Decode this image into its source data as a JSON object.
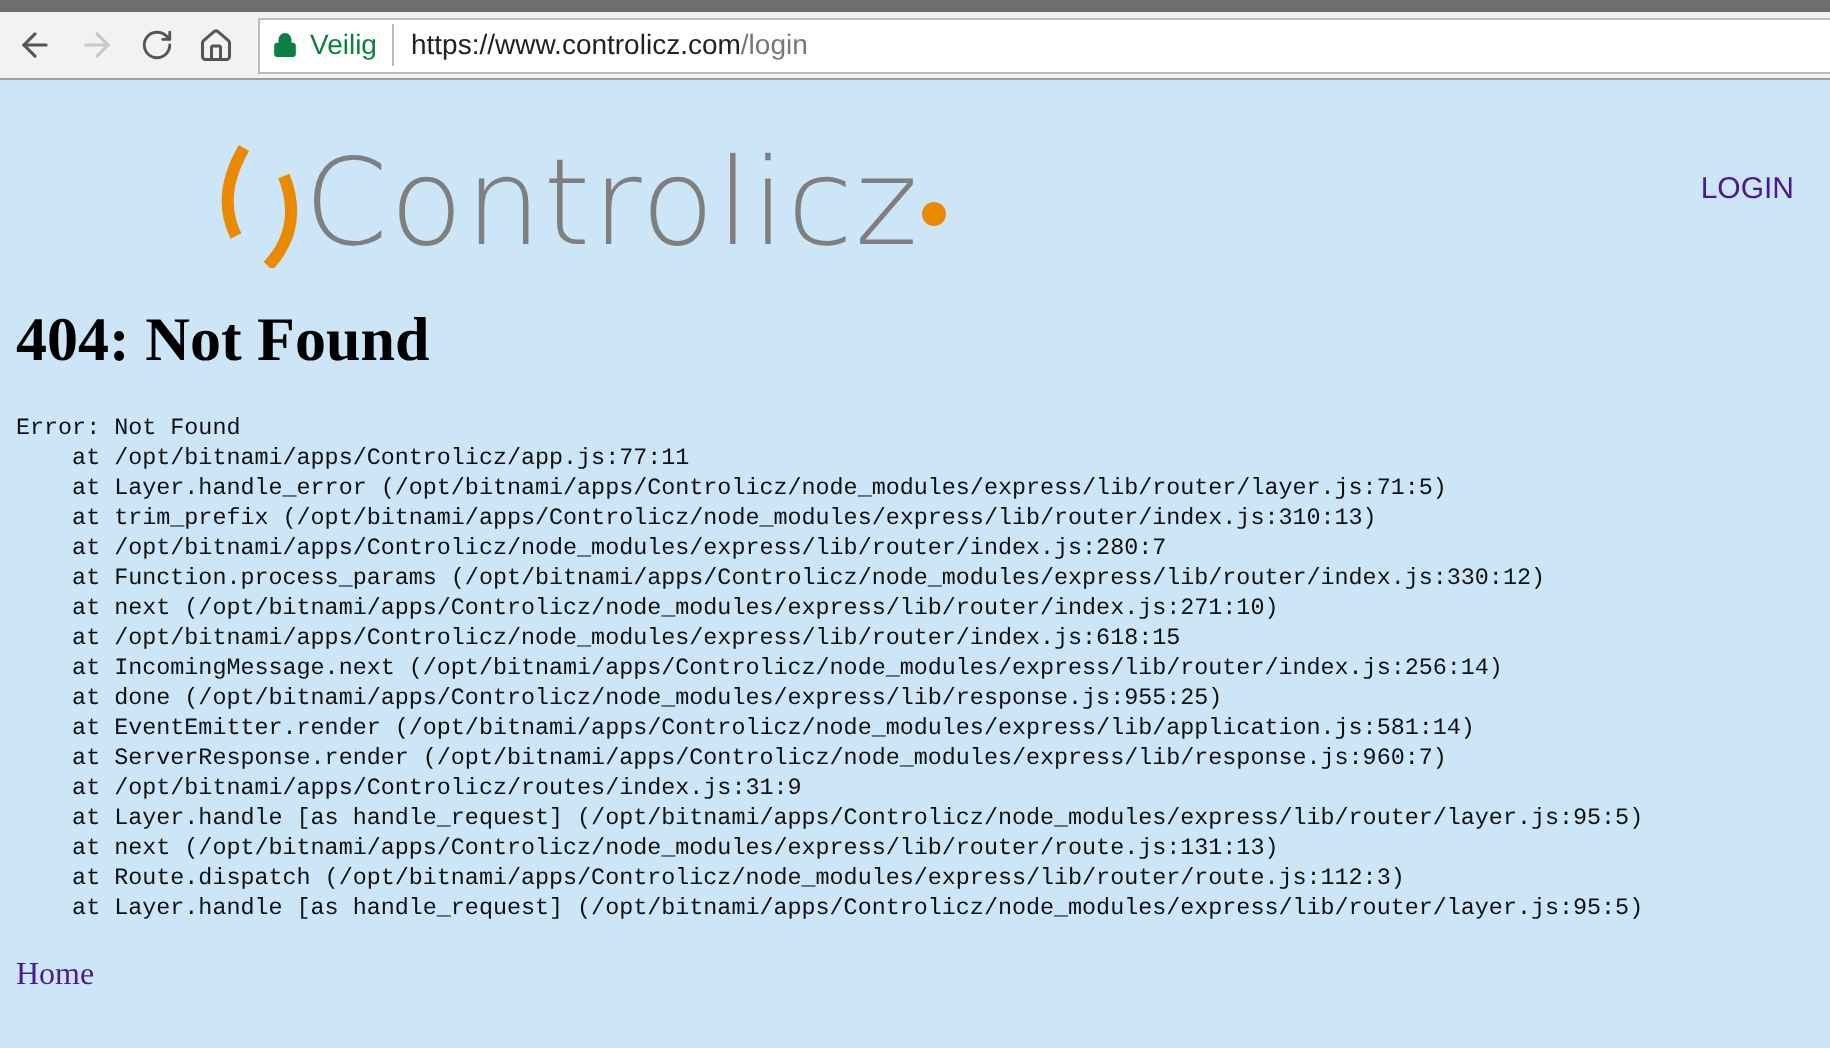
{
  "browser": {
    "security_label": "Veilig",
    "url_host": "https://www.controlicz.com",
    "url_path": "/login",
    "forward_disabled": true
  },
  "header": {
    "logo_text": "Controlicz",
    "nav_link": "LOGIN"
  },
  "heading": "404: Not Found",
  "error_lines": [
    "Error: Not Found",
    "    at /opt/bitnami/apps/Controlicz/app.js:77:11",
    "    at Layer.handle_error (/opt/bitnami/apps/Controlicz/node_modules/express/lib/router/layer.js:71:5)",
    "    at trim_prefix (/opt/bitnami/apps/Controlicz/node_modules/express/lib/router/index.js:310:13)",
    "    at /opt/bitnami/apps/Controlicz/node_modules/express/lib/router/index.js:280:7",
    "    at Function.process_params (/opt/bitnami/apps/Controlicz/node_modules/express/lib/router/index.js:330:12)",
    "    at next (/opt/bitnami/apps/Controlicz/node_modules/express/lib/router/index.js:271:10)",
    "    at /opt/bitnami/apps/Controlicz/node_modules/express/lib/router/index.js:618:15",
    "    at IncomingMessage.next (/opt/bitnami/apps/Controlicz/node_modules/express/lib/router/index.js:256:14)",
    "    at done (/opt/bitnami/apps/Controlicz/node_modules/express/lib/response.js:955:25)",
    "    at EventEmitter.render (/opt/bitnami/apps/Controlicz/node_modules/express/lib/application.js:581:14)",
    "    at ServerResponse.render (/opt/bitnami/apps/Controlicz/node_modules/express/lib/response.js:960:7)",
    "    at /opt/bitnami/apps/Controlicz/routes/index.js:31:9",
    "    at Layer.handle [as handle_request] (/opt/bitnami/apps/Controlicz/node_modules/express/lib/router/layer.js:95:5)",
    "    at next (/opt/bitnami/apps/Controlicz/node_modules/express/lib/router/route.js:131:13)",
    "    at Route.dispatch (/opt/bitnami/apps/Controlicz/node_modules/express/lib/router/route.js:112:3)",
    "    at Layer.handle [as handle_request] (/opt/bitnami/apps/Controlicz/node_modules/express/lib/router/layer.js:95:5)"
  ],
  "footer_link": "Home"
}
